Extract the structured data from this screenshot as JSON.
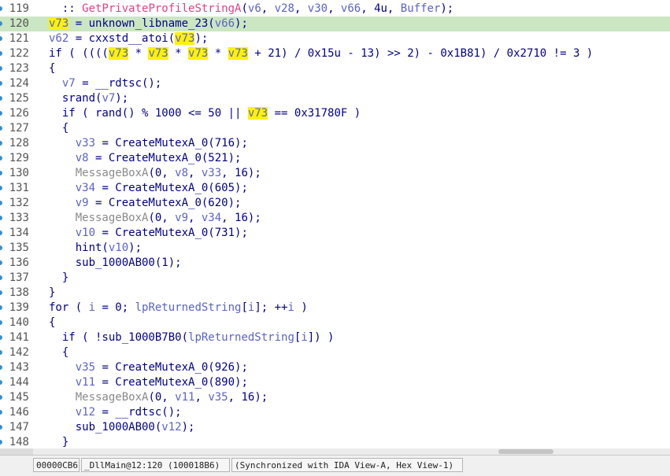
{
  "lines": [
    {
      "n": "119",
      "current": false,
      "tokens": [
        [
          "  ",
          "plain"
        ],
        [
          ":: ",
          "plain"
        ],
        [
          "GetPrivateProfileStringA",
          "api"
        ],
        [
          "(",
          "plain"
        ],
        [
          "v6",
          "var"
        ],
        [
          ", ",
          "plain"
        ],
        [
          "v28",
          "var"
        ],
        [
          ", ",
          "plain"
        ],
        [
          "v30",
          "var"
        ],
        [
          ", ",
          "plain"
        ],
        [
          "v66",
          "var"
        ],
        [
          ", 4u, ",
          "plain"
        ],
        [
          "Buffer",
          "var"
        ],
        [
          ");",
          "plain"
        ]
      ]
    },
    {
      "n": "120",
      "current": true,
      "tokens": [
        [
          "v73",
          "hl"
        ],
        [
          " = unknown_libname_23(",
          "plain"
        ],
        [
          "v66",
          "var"
        ],
        [
          ");",
          "plain"
        ]
      ]
    },
    {
      "n": "121",
      "current": false,
      "tokens": [
        [
          "v62",
          "var"
        ],
        [
          " = cxxstd__atoi(",
          "plain"
        ],
        [
          "v73",
          "hl"
        ],
        [
          ");",
          "plain"
        ]
      ]
    },
    {
      "n": "122",
      "current": false,
      "tokens": [
        [
          "if ( ((((",
          "plain"
        ],
        [
          "v73",
          "hl"
        ],
        [
          " * ",
          "plain"
        ],
        [
          "v73",
          "hl"
        ],
        [
          " * ",
          "plain"
        ],
        [
          "v73",
          "hl"
        ],
        [
          " * ",
          "plain"
        ],
        [
          "v73",
          "hl"
        ],
        [
          " + 21) / 0x15u - 13) >> 2) - 0x1B81) / 0x2710 != 3 )",
          "plain"
        ]
      ]
    },
    {
      "n": "123",
      "current": false,
      "tokens": [
        [
          "{",
          "plain"
        ]
      ]
    },
    {
      "n": "124",
      "current": false,
      "tokens": [
        [
          "  ",
          "plain"
        ],
        [
          "v7",
          "var"
        ],
        [
          " = __rdtsc();",
          "plain"
        ]
      ]
    },
    {
      "n": "125",
      "current": false,
      "tokens": [
        [
          "  srand(",
          "plain"
        ],
        [
          "v7",
          "var"
        ],
        [
          ");",
          "plain"
        ]
      ]
    },
    {
      "n": "126",
      "current": false,
      "tokens": [
        [
          "  if ( rand() % 1000 <= 50 || ",
          "plain"
        ],
        [
          "v73",
          "hl"
        ],
        [
          " == 0x31780F )",
          "plain"
        ]
      ]
    },
    {
      "n": "127",
      "current": false,
      "tokens": [
        [
          "  {",
          "plain"
        ]
      ]
    },
    {
      "n": "128",
      "current": false,
      "tokens": [
        [
          "    ",
          "plain"
        ],
        [
          "v33",
          "var"
        ],
        [
          " = CreateMutexA_0(716);",
          "plain"
        ]
      ]
    },
    {
      "n": "129",
      "current": false,
      "tokens": [
        [
          "    ",
          "plain"
        ],
        [
          "v8",
          "var"
        ],
        [
          " = CreateMutexA_0(521);",
          "plain"
        ]
      ]
    },
    {
      "n": "130",
      "current": false,
      "tokens": [
        [
          "    ",
          "plain"
        ],
        [
          "MessageBoxA",
          "gray"
        ],
        [
          "(0, ",
          "plain"
        ],
        [
          "v8",
          "var"
        ],
        [
          ", ",
          "plain"
        ],
        [
          "v33",
          "var"
        ],
        [
          ", 16);",
          "plain"
        ]
      ]
    },
    {
      "n": "131",
      "current": false,
      "tokens": [
        [
          "    ",
          "plain"
        ],
        [
          "v34",
          "var"
        ],
        [
          " = CreateMutexA_0(605);",
          "plain"
        ]
      ]
    },
    {
      "n": "132",
      "current": false,
      "tokens": [
        [
          "    ",
          "plain"
        ],
        [
          "v9",
          "var"
        ],
        [
          " = CreateMutexA_0(620);",
          "plain"
        ]
      ]
    },
    {
      "n": "133",
      "current": false,
      "tokens": [
        [
          "    ",
          "plain"
        ],
        [
          "MessageBoxA",
          "gray"
        ],
        [
          "(0, ",
          "plain"
        ],
        [
          "v9",
          "var"
        ],
        [
          ", ",
          "plain"
        ],
        [
          "v34",
          "var"
        ],
        [
          ", 16);",
          "plain"
        ]
      ]
    },
    {
      "n": "134",
      "current": false,
      "tokens": [
        [
          "    ",
          "plain"
        ],
        [
          "v10",
          "var"
        ],
        [
          " = CreateMutexA_0(731);",
          "plain"
        ]
      ]
    },
    {
      "n": "135",
      "current": false,
      "tokens": [
        [
          "    hint(",
          "plain"
        ],
        [
          "v10",
          "var"
        ],
        [
          ");",
          "plain"
        ]
      ]
    },
    {
      "n": "136",
      "current": false,
      "tokens": [
        [
          "    sub_1000AB00(1);",
          "plain"
        ]
      ]
    },
    {
      "n": "137",
      "current": false,
      "tokens": [
        [
          "  }",
          "plain"
        ]
      ]
    },
    {
      "n": "138",
      "current": false,
      "tokens": [
        [
          "}",
          "plain"
        ]
      ]
    },
    {
      "n": "139",
      "current": false,
      "tokens": [
        [
          "for ( ",
          "plain"
        ],
        [
          "i",
          "var"
        ],
        [
          " = 0; ",
          "plain"
        ],
        [
          "lpReturnedString",
          "var"
        ],
        [
          "[",
          "plain"
        ],
        [
          "i",
          "var"
        ],
        [
          "]; ++",
          "plain"
        ],
        [
          "i",
          "var"
        ],
        [
          " )",
          "plain"
        ]
      ]
    },
    {
      "n": "140",
      "current": false,
      "tokens": [
        [
          "{",
          "plain"
        ]
      ]
    },
    {
      "n": "141",
      "current": false,
      "tokens": [
        [
          "  if ( !sub_1000B7B0(",
          "plain"
        ],
        [
          "lpReturnedString",
          "var"
        ],
        [
          "[",
          "plain"
        ],
        [
          "i",
          "var"
        ],
        [
          "]) )",
          "plain"
        ]
      ]
    },
    {
      "n": "142",
      "current": false,
      "tokens": [
        [
          "  {",
          "plain"
        ]
      ]
    },
    {
      "n": "143",
      "current": false,
      "tokens": [
        [
          "    ",
          "plain"
        ],
        [
          "v35",
          "var"
        ],
        [
          " = CreateMutexA_0(926);",
          "plain"
        ]
      ]
    },
    {
      "n": "144",
      "current": false,
      "tokens": [
        [
          "    ",
          "plain"
        ],
        [
          "v11",
          "var"
        ],
        [
          " = CreateMutexA_0(890);",
          "plain"
        ]
      ]
    },
    {
      "n": "145",
      "current": false,
      "tokens": [
        [
          "    ",
          "plain"
        ],
        [
          "MessageBoxA",
          "gray"
        ],
        [
          "(0, ",
          "plain"
        ],
        [
          "v11",
          "var"
        ],
        [
          ", ",
          "plain"
        ],
        [
          "v35",
          "var"
        ],
        [
          ", 16);",
          "plain"
        ]
      ]
    },
    {
      "n": "146",
      "current": false,
      "tokens": [
        [
          "    ",
          "plain"
        ],
        [
          "v12",
          "var"
        ],
        [
          " = __rdtsc();",
          "plain"
        ]
      ]
    },
    {
      "n": "147",
      "current": false,
      "tokens": [
        [
          "    sub_1000AB00(",
          "plain"
        ],
        [
          "v12",
          "var"
        ],
        [
          ");",
          "plain"
        ]
      ]
    },
    {
      "n": "148",
      "current": false,
      "tokens": [
        [
          "  }",
          "plain"
        ]
      ]
    }
  ],
  "status_bar": {
    "address": "00000CB6",
    "location": "_DllMain@12:120 (100018B6)",
    "sync": "(Synchronized with IDA View-A, Hex View-1)"
  },
  "colors": {
    "current_line": "#cbe6c3",
    "highlight": "#fff200",
    "variable": "#5a63c8",
    "api_call": "#e0408a",
    "code_text": "#00008b",
    "line_number": "#555555",
    "breakpoint_dot": "#2f8fd8"
  }
}
